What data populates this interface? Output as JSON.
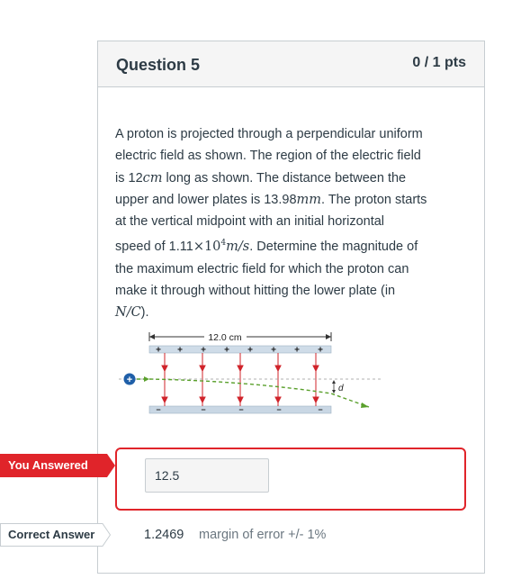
{
  "question": {
    "title": "Question 5",
    "points": "0 / 1 pts",
    "text_lines": [
      "A proton is projected through a perpendicular  uniform",
      "electric field  as shown.   The region of the electric field",
      "is 12",
      "long as shown.  The distance between the",
      "upper and lower plates is 13.98",
      ".  The proton starts",
      "at the vertical  midpoint  with an initial  horizontal",
      "speed of 1.11",
      ".  Determine the magnitude of",
      "the maximum  electric  field for which  the proton can",
      "make it through without hitting the lower plate (in",
      ")."
    ],
    "math": {
      "cm": "cm",
      "mm": "mm",
      "times": "×10",
      "exp": "4",
      "speed_unit": "m/s",
      "field_unit": "N/C"
    }
  },
  "figure": {
    "length_label": "12.0 cm",
    "d_label": "d",
    "plus_sign": "+",
    "minus_sign": "−",
    "proton_sign": "+",
    "colors": {
      "field": "#d0232a",
      "path": "#5aa02c",
      "plate_top": "#cfdce8",
      "plate_bottom": "#c9d7e4",
      "proton": "#1f5fa8"
    }
  },
  "answers": {
    "you_answered_label": "You Answered",
    "you_answered_value": "12.5",
    "correct_label": "Correct Answer",
    "correct_value": "1.2469",
    "margin": "margin of error +/- 1%"
  },
  "colors": {
    "wrong": "#e0242a",
    "border": "#c7cdd1",
    "header_bg": "#f5f5f5",
    "text": "#2d3b45"
  }
}
